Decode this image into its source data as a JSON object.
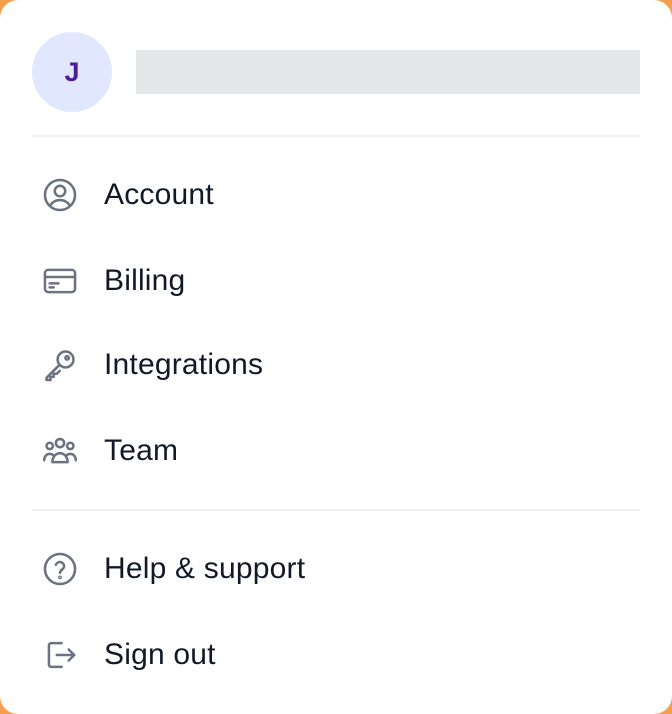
{
  "user": {
    "avatar_initial": "J"
  },
  "menu": {
    "account": {
      "label": "Account",
      "icon": "user-circle-icon"
    },
    "billing": {
      "label": "Billing",
      "icon": "credit-card-icon"
    },
    "integrations": {
      "label": "Integrations",
      "icon": "key-icon"
    },
    "team": {
      "label": "Team",
      "icon": "users-group-icon"
    },
    "help": {
      "label": "Help & support",
      "icon": "question-circle-icon"
    },
    "signout": {
      "label": "Sign out",
      "icon": "sign-out-icon"
    }
  },
  "colors": {
    "avatar_bg": "#e0e7ff",
    "avatar_text": "#4c1d95",
    "icon_stroke": "#6b7280",
    "label_text": "#111827",
    "placeholder": "#e5e7eb",
    "divider": "#eef0f3",
    "backdrop": "#f59e4b"
  }
}
